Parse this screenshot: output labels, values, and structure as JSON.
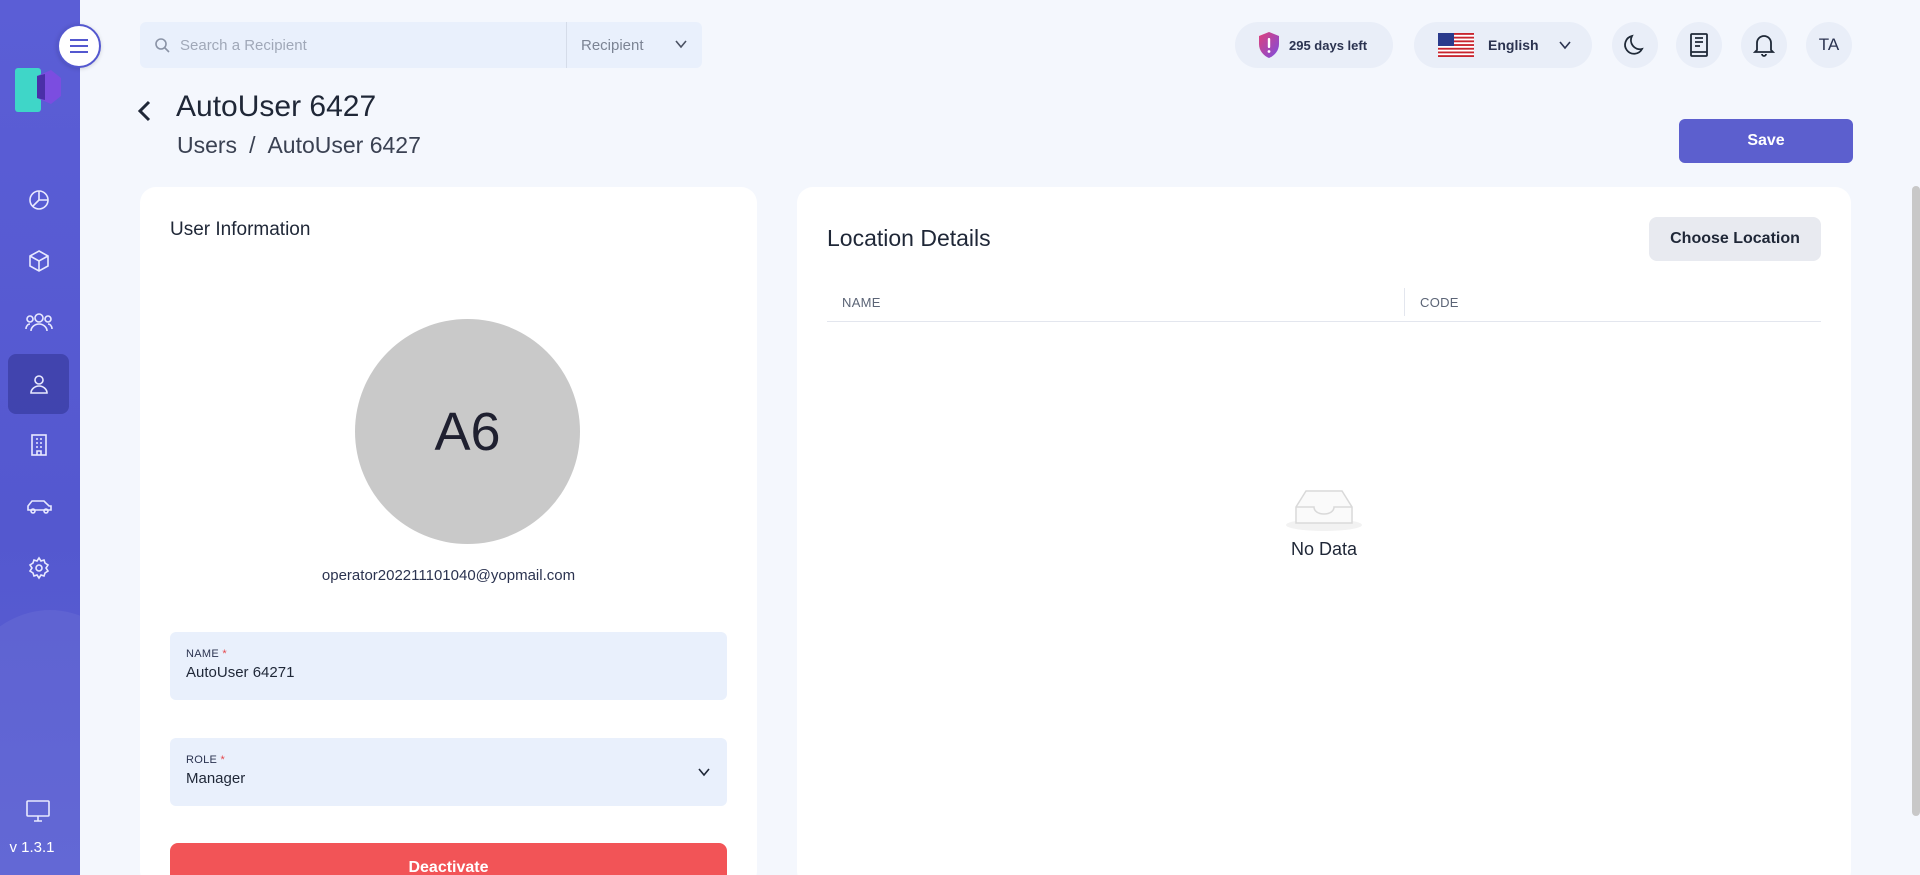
{
  "app": {
    "version": "v 1.3.1"
  },
  "sidebar": {
    "items": [
      {
        "icon": "dashboard-icon"
      },
      {
        "icon": "package-icon"
      },
      {
        "icon": "recipients-icon"
      },
      {
        "icon": "user-icon",
        "active": true
      },
      {
        "icon": "building-icon"
      },
      {
        "icon": "vehicle-icon"
      },
      {
        "icon": "settings-icon"
      }
    ]
  },
  "topbar": {
    "search_placeholder": "Search a Recipient",
    "search_scope": "Recipient",
    "license": "295 days left",
    "language": "English",
    "user_initials": "TA"
  },
  "header": {
    "title": "AutoUser 6427",
    "breadcrumb": [
      "Users",
      "/",
      "AutoUser 6427"
    ],
    "save_label": "Save"
  },
  "user_info": {
    "title": "User Information",
    "avatar_initials": "A6",
    "email": "operator202211101040@yopmail.com",
    "name_label": "NAME",
    "name_value": "AutoUser 64271",
    "role_label": "ROLE",
    "role_value": "Manager",
    "deactivate_label": "Deactivate"
  },
  "location": {
    "title": "Location Details",
    "choose_label": "Choose Location",
    "columns": [
      "NAME",
      "CODE"
    ],
    "empty_text": "No Data"
  },
  "colors": {
    "primary": "#5c5fce",
    "danger": "#f25457",
    "sidebar": "#5458cf"
  }
}
